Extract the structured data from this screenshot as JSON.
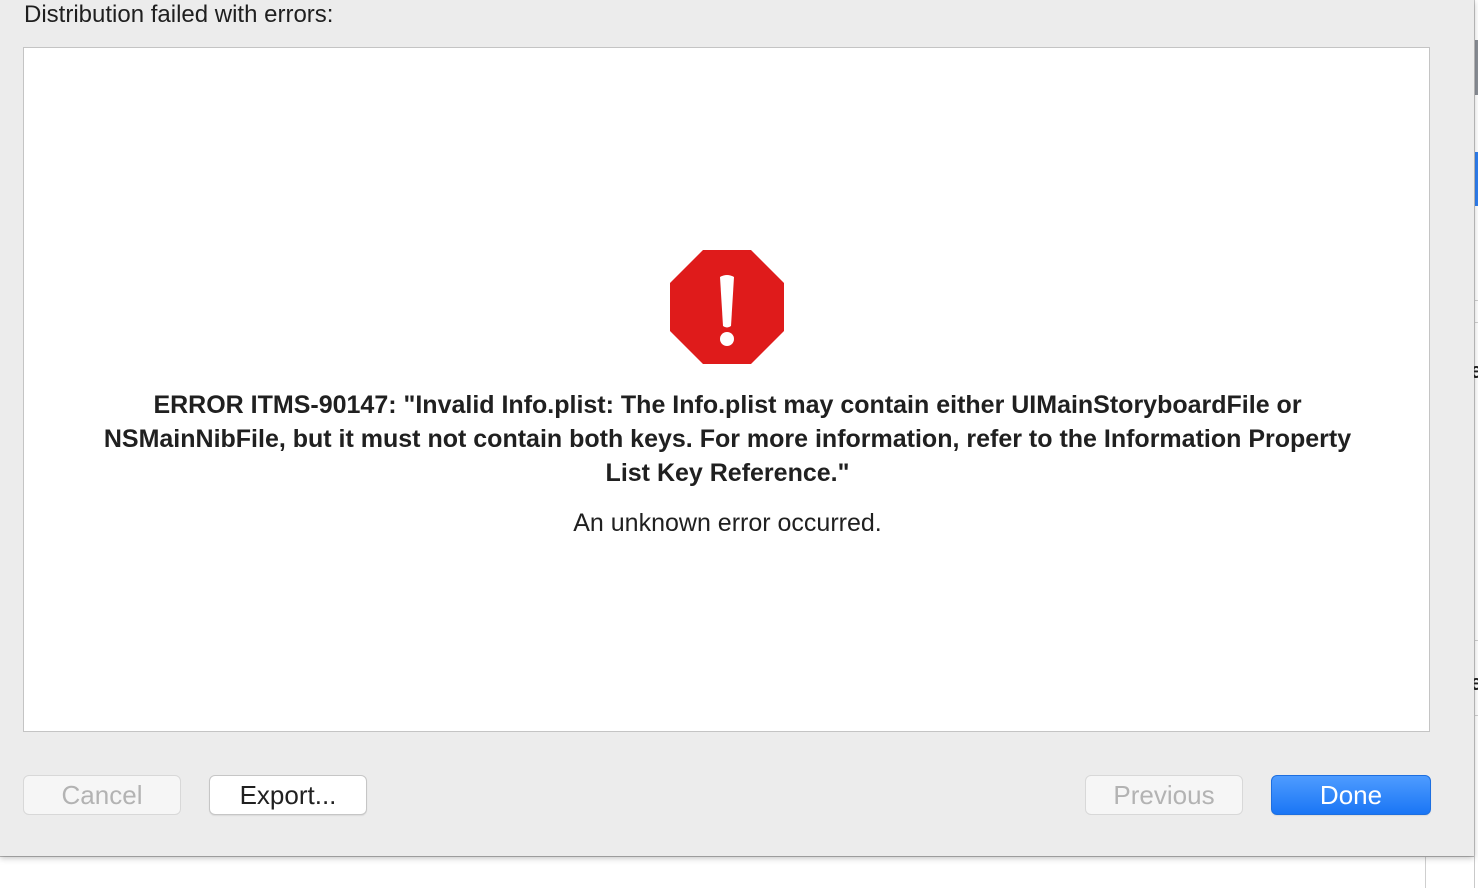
{
  "dialog": {
    "heading": "Distribution failed with errors:",
    "icon": "stop-error-icon",
    "error_title": "ERROR ITMS-90147: \"Invalid Info.plist: The Info.plist may contain either UIMainStoryboardFile or NSMainNibFile, but it must not contain both keys. For more information, refer to the Information Property List Key Reference.\"",
    "error_detail": "An unknown error occurred.",
    "colors": {
      "stop_icon": "#df1b1b",
      "primary_button": "#1a76f5"
    }
  },
  "buttons": {
    "cancel": "Cancel",
    "export": "Export...",
    "previous": "Previous",
    "done": "Done"
  }
}
